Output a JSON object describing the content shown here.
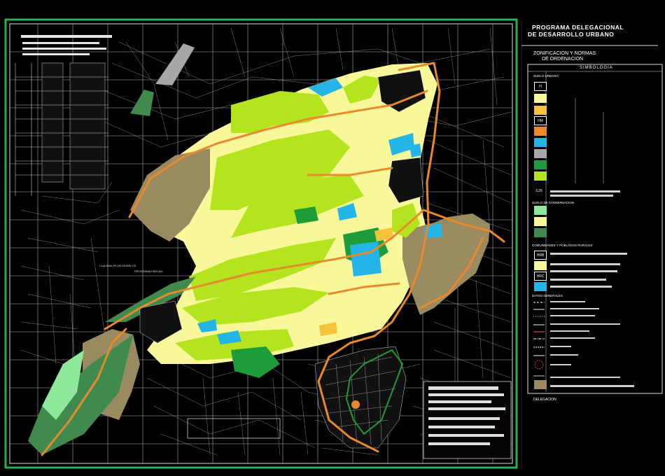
{
  "title_block": {
    "program_line1": "PROGRAMA DELEGACIONAL",
    "program_line2": "DE DESARROLLO URBANO",
    "plan_line1": "ZONIFICACION Y NORMAS",
    "plan_line2": "DE ORDENACION"
  },
  "legend": {
    "heading": "SIMBOLOGIA",
    "section_urban": "SUELO URBANO",
    "section_conservation": "SUELO DE CONSERVACION",
    "section_rural": "COMUNIDADES Y POBLADOS RURALES",
    "section_general": "DATOS GENERALES",
    "code_h": "H",
    "code_hm": "HM",
    "code_hrb": "HRB",
    "code_hrc": "HRC",
    "number_label": "3,25",
    "footer": "DELEGACION"
  },
  "colors": {
    "background": "#000000",
    "urban_lines": "#cfcfcf",
    "roads": "#e8892b",
    "habitacional": "#f8f79a",
    "habitacional_comercial": "#f6c23a",
    "mixto": "#ef8a25",
    "equipamiento": "#23b4e8",
    "industria": "#a7a7a7",
    "espacios_abiertos": "#1f9c3a",
    "areas_verdes": "#b4e41d",
    "conservacion_light": "#8ee89a",
    "conservacion_dark": "#3f8a4c",
    "poblados": "#9a8a60",
    "frame_green": "#2cb04a"
  },
  "map_labels": {
    "label_a": "CUAJIMALPA DE MORELOS",
    "label_b": "PROGRAMA PARCIAL"
  }
}
